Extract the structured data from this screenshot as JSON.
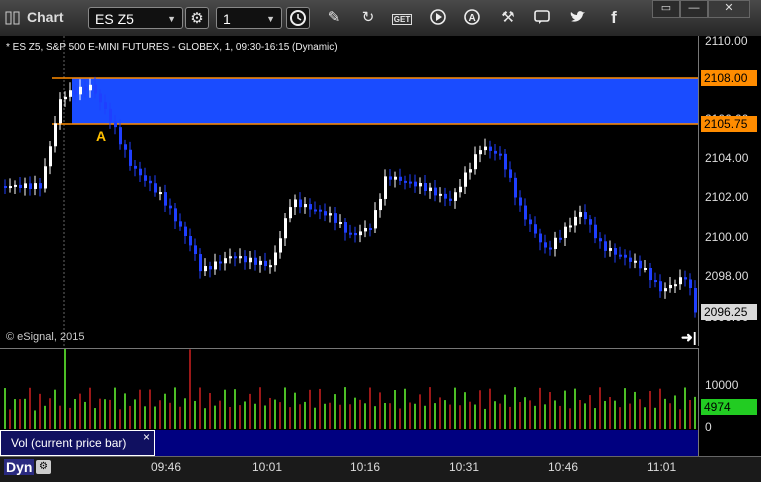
{
  "window": {
    "title": "Chart",
    "controls": [
      "▭",
      "—",
      "✕"
    ]
  },
  "toolbar": {
    "symbol": "ES Z5",
    "interval": "1",
    "icons": [
      "settings-icon",
      "clock-icon",
      "pencil-icon",
      "refresh-icon",
      "get-icon",
      "play-icon",
      "a-icon",
      "tools-icon",
      "chat-icon",
      "twitter-icon",
      "facebook-icon"
    ],
    "get_label": "GET"
  },
  "chart": {
    "symbol_line": "* ES Z5, S&P 500 E-MINI FUTURES - GLOBEX, 1, 09:30-16:15 (Dynamic)",
    "copyright": "© eSignal, 2015",
    "marker": "A",
    "zone_color": "#1a4cff",
    "up_color": "#ffffff",
    "down_color": "#1f3fff",
    "price_ticks": [
      "2110.00",
      "2108.00",
      "2106.00",
      "2104.00",
      "2102.00",
      "2100.00",
      "2098.00",
      "2096.00"
    ],
    "price_tags": {
      "upper": "2108.00",
      "lower": "2105.75",
      "last": "2096.25"
    },
    "time_ticks": [
      "09:46",
      "10:01",
      "10:16",
      "10:31",
      "10:46",
      "11:01"
    ]
  },
  "volume": {
    "label": "Vol (current price bar)",
    "close": "×",
    "ticks": [
      "10000",
      "0"
    ],
    "last_value": "4974",
    "up_color": "#66ff33",
    "down_color": "#d02020"
  },
  "bottom": {
    "mode": "Dyn"
  }
}
